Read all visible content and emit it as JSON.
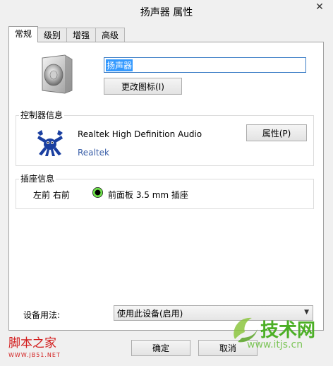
{
  "window": {
    "title": "扬声器 属性",
    "close_glyph": "✕"
  },
  "tabs": [
    {
      "label": "常规",
      "active": true
    },
    {
      "label": "级别",
      "active": false
    },
    {
      "label": "增强",
      "active": false
    },
    {
      "label": "高级",
      "active": false
    }
  ],
  "general": {
    "device_name": "扬声器",
    "change_icon_label": "更改图标(I)"
  },
  "controller": {
    "group_label": "控制器信息",
    "name": "Realtek High Definition Audio",
    "vendor": "Realtek",
    "properties_label": "属性(P)"
  },
  "jack": {
    "group_label": "插座信息",
    "channels": "左前 右前",
    "description": "前面板 3.5 mm 插座",
    "color": "#6ee04a"
  },
  "usage": {
    "label": "设备用法:",
    "selected": "使用此设备(启用)"
  },
  "footer": {
    "ok_label": "确定",
    "cancel_label": "取消"
  },
  "watermarks": {
    "left_title": "脚本之家",
    "left_url": "WWW.JB51.NET",
    "right_brand": "技术网",
    "right_url": "www.itjs.cn"
  }
}
